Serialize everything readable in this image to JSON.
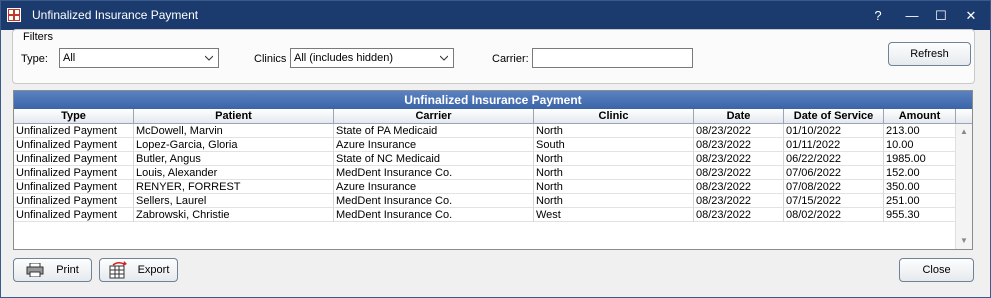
{
  "window": {
    "title": "Unfinalized Insurance Payment",
    "help_label": "?",
    "minimize_label": "—",
    "maximize_label": "☐",
    "close_label": "✕"
  },
  "filters": {
    "group_label": "Filters",
    "type_label": "Type:",
    "type_value": "All",
    "clinics_label": "Clinics",
    "clinics_value": "All (includes hidden)",
    "carrier_label": "Carrier:",
    "carrier_value": "",
    "refresh_label": "Refresh"
  },
  "grid": {
    "title": "Unfinalized Insurance Payment",
    "columns": [
      "Type",
      "Patient",
      "Carrier",
      "Clinic",
      "Date",
      "Date of Service",
      "Amount"
    ],
    "rows": [
      [
        "Unfinalized Payment",
        "McDowell, Marvin",
        "State of PA Medicaid",
        "North",
        "08/23/2022",
        "01/10/2022",
        "213.00"
      ],
      [
        "Unfinalized Payment",
        "Lopez-Garcia, Gloria",
        "Azure Insurance",
        "South",
        "08/23/2022",
        "01/11/2022",
        "10.00"
      ],
      [
        "Unfinalized Payment",
        "Butler, Angus",
        "State of NC Medicaid",
        "North",
        "08/23/2022",
        "06/22/2022",
        "1985.00"
      ],
      [
        "Unfinalized Payment",
        "Louis, Alexander",
        "MedDent Insurance Co.",
        "North",
        "08/23/2022",
        "07/06/2022",
        "152.00"
      ],
      [
        "Unfinalized Payment",
        "RENYER, FORREST",
        "Azure Insurance",
        "North",
        "08/23/2022",
        "07/08/2022",
        "350.00"
      ],
      [
        "Unfinalized Payment",
        "Sellers, Laurel",
        "MedDent Insurance Co.",
        "North",
        "08/23/2022",
        "07/15/2022",
        "251.00"
      ],
      [
        "Unfinalized Payment",
        "Zabrowski, Christie",
        "MedDent Insurance Co.",
        "West",
        "08/23/2022",
        "08/02/2022",
        "955.30"
      ]
    ]
  },
  "footer": {
    "print_label": "Print",
    "export_label": "Export",
    "close_label": "Close"
  },
  "colors": {
    "titlebar": "#1b3a6e",
    "grid_title": "#4a72b6"
  }
}
